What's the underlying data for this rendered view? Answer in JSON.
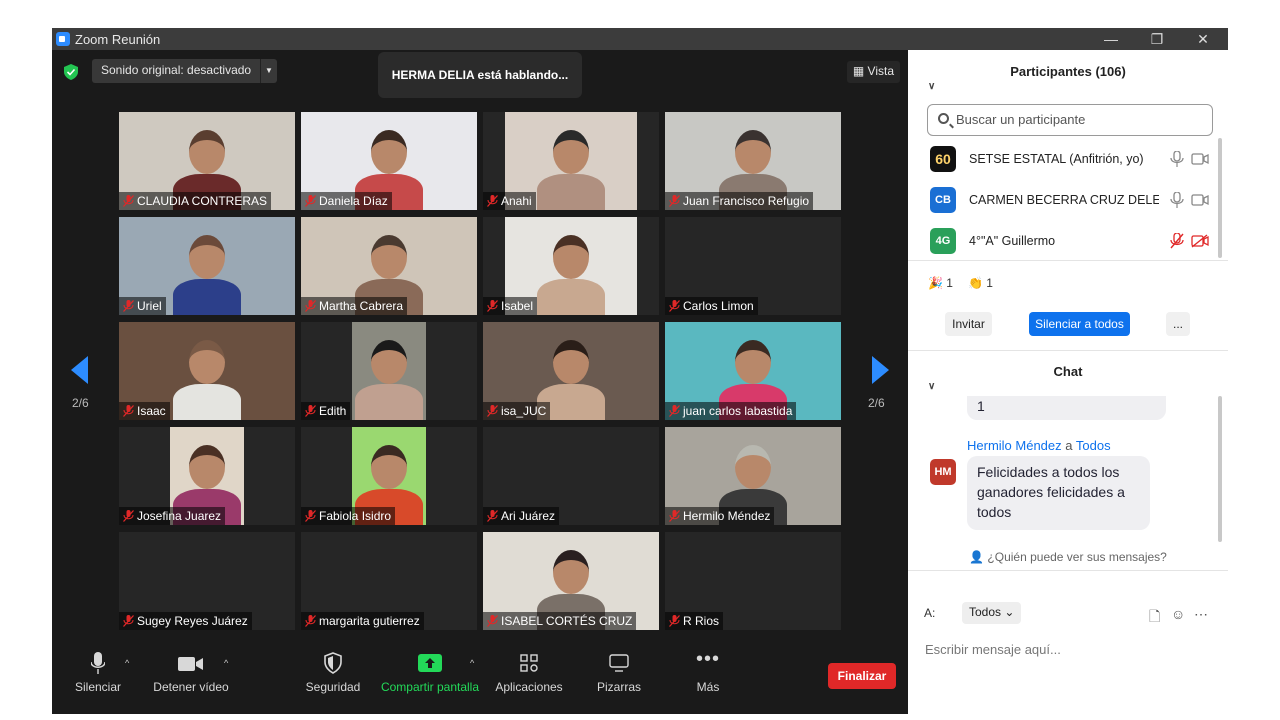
{
  "window": {
    "title": "Zoom Reunión"
  },
  "meeting": {
    "audio_label": "Sonido original: desactivado",
    "speaking": "HERMA DELIA está hablando...",
    "view_label": "Vista",
    "page_left": "2/6",
    "page_right": "2/6"
  },
  "participants_grid": [
    {
      "name": "CLAUDIA CONTRERAS"
    },
    {
      "name": "Daniela Díaz"
    },
    {
      "name": "Anahi"
    },
    {
      "name": "Juan Francisco Refugio"
    },
    {
      "name": "Uriel"
    },
    {
      "name": "Martha Cabrera"
    },
    {
      "name": "Isabel"
    },
    {
      "name": "Carlos Limon"
    },
    {
      "name": "Isaac"
    },
    {
      "name": "Edith"
    },
    {
      "name": "isa_JUC"
    },
    {
      "name": "juan carlos labastida"
    },
    {
      "name": "Josefina Juarez"
    },
    {
      "name": "Fabiola Isidro"
    },
    {
      "name": "Ari Juárez"
    },
    {
      "name": "Hermilo Méndez"
    },
    {
      "name": "Sugey Reyes Juárez"
    },
    {
      "name": "margarita gutierrez"
    },
    {
      "name": "ISABEL CORTÉS CRUZ"
    },
    {
      "name": "R Rios"
    }
  ],
  "toolbar": {
    "mute": "Silenciar",
    "video": "Detener vídeo",
    "security": "Seguridad",
    "share": "Compartir pantalla",
    "apps": "Aplicaciones",
    "whiteboards": "Pizarras",
    "more": "Más",
    "end": "Finalizar"
  },
  "panel": {
    "participants_title": "Participantes (106)",
    "search_placeholder": "Buscar un participante",
    "list": [
      {
        "avatar": "60",
        "name": "SETSE ESTATAL (Anfitrión, yo)"
      },
      {
        "avatar": "CB",
        "name": "CARMEN BECERRA CRUZ DELE..."
      },
      {
        "avatar": "4G",
        "name": "4°\"A\" Guillermo"
      }
    ],
    "reactions": [
      {
        "icon": "party-popper-icon",
        "glyph": "🎉",
        "count": "1"
      },
      {
        "icon": "clap-icon",
        "glyph": "👏",
        "count": "1"
      }
    ],
    "invite": "Invitar",
    "mute_all": "Silenciar a todos",
    "more": "...",
    "chat_title": "Chat",
    "prev_message": "1",
    "message": {
      "sender": "Hermilo Méndez",
      "to_word": "a",
      "recipient": "Todos",
      "avatar": "HM",
      "text_lines": [
        "Felicidades a todos los",
        "ganadores  felicidades a",
        "todos"
      ]
    },
    "who_can_see": "¿Quién puede ver sus mensajes?",
    "to_label": "A:",
    "to_value": "Todos",
    "compose_placeholder": "Escribir mensaje aquí..."
  },
  "colors": {
    "accent": "#2d8cff",
    "end_red": "#e02828",
    "share_green": "#23d959",
    "chat_blue": "#0e72ed",
    "avatar_cb": "#1a6fd4",
    "avatar_4g": "#2aa05a",
    "avatar_hm": "#c0392b"
  }
}
